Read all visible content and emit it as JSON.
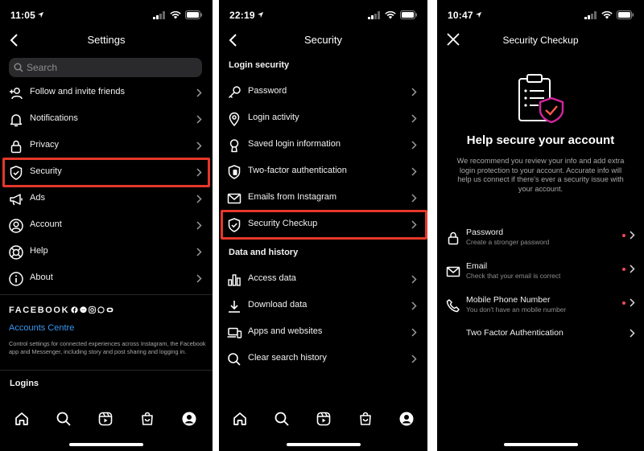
{
  "screen1": {
    "time": "11:05",
    "title": "Settings",
    "search_placeholder": "Search",
    "items": [
      {
        "label": "Follow and invite friends"
      },
      {
        "label": "Notifications"
      },
      {
        "label": "Privacy"
      },
      {
        "label": "Security"
      },
      {
        "label": "Ads"
      },
      {
        "label": "Account"
      },
      {
        "label": "Help"
      },
      {
        "label": "About"
      }
    ],
    "facebook_heading": "FACEBOOK",
    "accounts_centre": "Accounts Centre",
    "accounts_desc": "Control settings for connected experiences across Instagram, the Facebook app and Messenger, including story and post sharing and logging in.",
    "logins_heading": "Logins"
  },
  "screen2": {
    "time": "22:19",
    "title": "Security",
    "login_heading": "Login security",
    "login_items": [
      {
        "label": "Password"
      },
      {
        "label": "Login activity"
      },
      {
        "label": "Saved login information"
      },
      {
        "label": "Two-factor authentication"
      },
      {
        "label": "Emails from Instagram"
      },
      {
        "label": "Security Checkup"
      }
    ],
    "data_heading": "Data and history",
    "data_items": [
      {
        "label": "Access data"
      },
      {
        "label": "Download data"
      },
      {
        "label": "Apps and websites"
      },
      {
        "label": "Clear search history"
      }
    ]
  },
  "screen3": {
    "time": "10:47",
    "title": "Security Checkup",
    "heading": "Help secure your account",
    "description": "We recommend you review your info and add extra login protection to your account. Accurate info will help us connect if there's ever a security issue with your account.",
    "items": [
      {
        "title": "Password",
        "subtitle": "Create a stronger password"
      },
      {
        "title": "Email",
        "subtitle": "Check that your email is correct"
      },
      {
        "title": "Mobile Phone Number",
        "subtitle": "You don't have an mobile number"
      },
      {
        "title": "Two Factor Authentication",
        "subtitle": ""
      }
    ]
  },
  "colors": {
    "background": "#000000",
    "highlight": "#e6372a",
    "link": "#3797f0",
    "alert_dot": "#ed4956"
  }
}
